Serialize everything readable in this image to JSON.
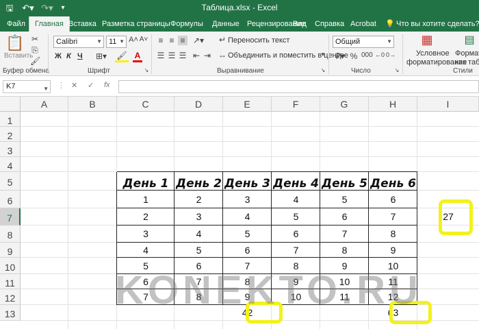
{
  "app": {
    "window_title": "Таблица.xlsx  -  Excel",
    "quick_access": {
      "save_icon": "save-icon",
      "undo_icon": "undo-icon",
      "redo_icon": "redo-icon"
    }
  },
  "tabs": [
    {
      "label": "Файл"
    },
    {
      "label": "Главная",
      "active": true
    },
    {
      "label": "Вставка"
    },
    {
      "label": "Разметка страницы"
    },
    {
      "label": "Формулы"
    },
    {
      "label": "Данные"
    },
    {
      "label": "Рецензирование"
    },
    {
      "label": "Вид"
    },
    {
      "label": "Справка"
    },
    {
      "label": "Acrobat"
    },
    {
      "label": "Что вы хотите сделать?"
    }
  ],
  "ribbon": {
    "clipboard": {
      "paste_label": "Вставить",
      "group_label": "Буфер обмена"
    },
    "font": {
      "name": "Calibri",
      "size": "11",
      "bold": "Ж",
      "italic": "К",
      "underline": "Ч",
      "group_label": "Шрифт"
    },
    "alignment": {
      "wrap_text": "Переносить текст",
      "merge_center": "Объединить и поместить в центре",
      "group_label": "Выравнивание"
    },
    "number": {
      "format": "Общий",
      "group_label": "Число"
    },
    "styles": {
      "conditional": "Условное",
      "conditional2": "форматирование",
      "format_as": "Формати",
      "format_as2": "как табл",
      "group_label": "Стили"
    }
  },
  "formula_bar": {
    "name_box": "K7",
    "cancel": "✕",
    "enter": "✓",
    "fx": "fx",
    "value": ""
  },
  "columns": [
    "A",
    "B",
    "C",
    "D",
    "E",
    "F",
    "G",
    "H",
    "I"
  ],
  "rows": [
    "1",
    "2",
    "3",
    "4",
    "5",
    "6",
    "7",
    "8",
    "9",
    "10",
    "11",
    "12",
    "13"
  ],
  "selected": {
    "row": "7"
  },
  "table": {
    "headers": [
      "День 1",
      "День 2",
      "День 3",
      "День 4",
      "День 5",
      "День 6"
    ],
    "rows": [
      [
        "1",
        "2",
        "3",
        "4",
        "5",
        "6"
      ],
      [
        "2",
        "3",
        "4",
        "5",
        "6",
        "7"
      ],
      [
        "3",
        "4",
        "5",
        "6",
        "7",
        "8"
      ],
      [
        "4",
        "5",
        "6",
        "7",
        "8",
        "9"
      ],
      [
        "5",
        "6",
        "7",
        "8",
        "9",
        "10"
      ],
      [
        "6",
        "7",
        "8",
        "9",
        "10",
        "11"
      ],
      [
        "7",
        "8",
        "9",
        "10",
        "11",
        "12"
      ]
    ]
  },
  "results": {
    "e13": "42",
    "h13": "63",
    "i7": "27"
  },
  "highlight_color": "#f2f21a",
  "accent_color": "#217346",
  "watermark": "KONEKTO.RU"
}
